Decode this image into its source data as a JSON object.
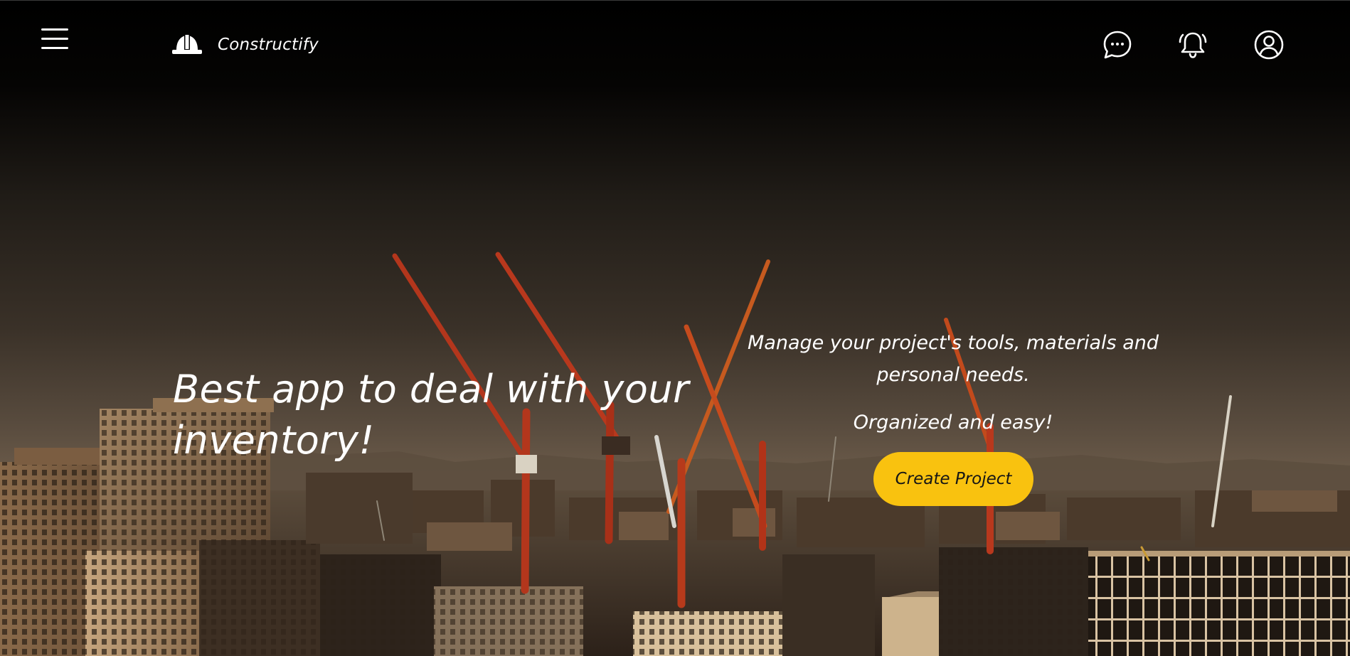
{
  "brand": {
    "name": "Constructify",
    "logo_icon": "hard-hat-icon"
  },
  "header": {
    "menu_icon": "hamburger-menu-icon",
    "icons": [
      "chat-bubble-icon",
      "bell-icon",
      "user-account-icon"
    ]
  },
  "hero": {
    "headline": "Best app to deal with your inventory!",
    "tagline": "Manage your project's tools, materials and personal needs.",
    "subtagline": "Organized and easy!",
    "cta_label": "Create Project",
    "background_image": "construction-cranes-city-skyline-at-sunset"
  },
  "colors": {
    "accent": "#f9c20f",
    "header_bg": "#000000",
    "text": "#ffffff",
    "cta_text": "#161616"
  }
}
